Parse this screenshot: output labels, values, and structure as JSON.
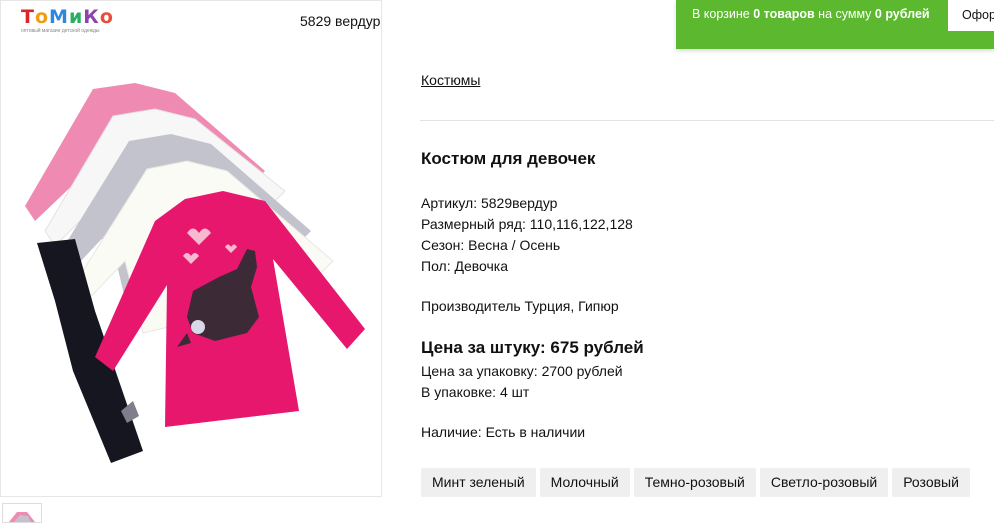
{
  "header": {
    "logo_text": "ТоМиКо",
    "logo_tagline": "оптовый магазин детской одежды",
    "sku_label": "5829 вердур"
  },
  "cart": {
    "text_prefix": "В корзине ",
    "count": "0 товаров",
    "text_mid": " на сумму ",
    "sum": "0 рублей",
    "checkout_label": "Оформить"
  },
  "product": {
    "breadcrumb": "Костюмы",
    "title": "Костюм для девочек",
    "attributes": [
      "Артикул: 5829вердур",
      "Размерный ряд: 110,116,122,128",
      "Сезон: Весна / Осень",
      "Пол: Девочка"
    ],
    "manufacturer": "Производитель Турция, Гипюр",
    "price_each": "Цена за штуку: 675 рублей",
    "price_pack": "Цена за упаковку: 2700 рублей",
    "pack_qty": "В упаковке: 4 шт",
    "availability": "Наличие: Есть в наличии",
    "colors": [
      "Минт зеленый",
      "Молочный",
      "Темно-розовый",
      "Светло-розовый",
      "Розовый"
    ]
  },
  "theme": {
    "cart_green": "#5cb82e",
    "hot_pink": "#e6176d",
    "light_pink": "#ef8bb3"
  }
}
